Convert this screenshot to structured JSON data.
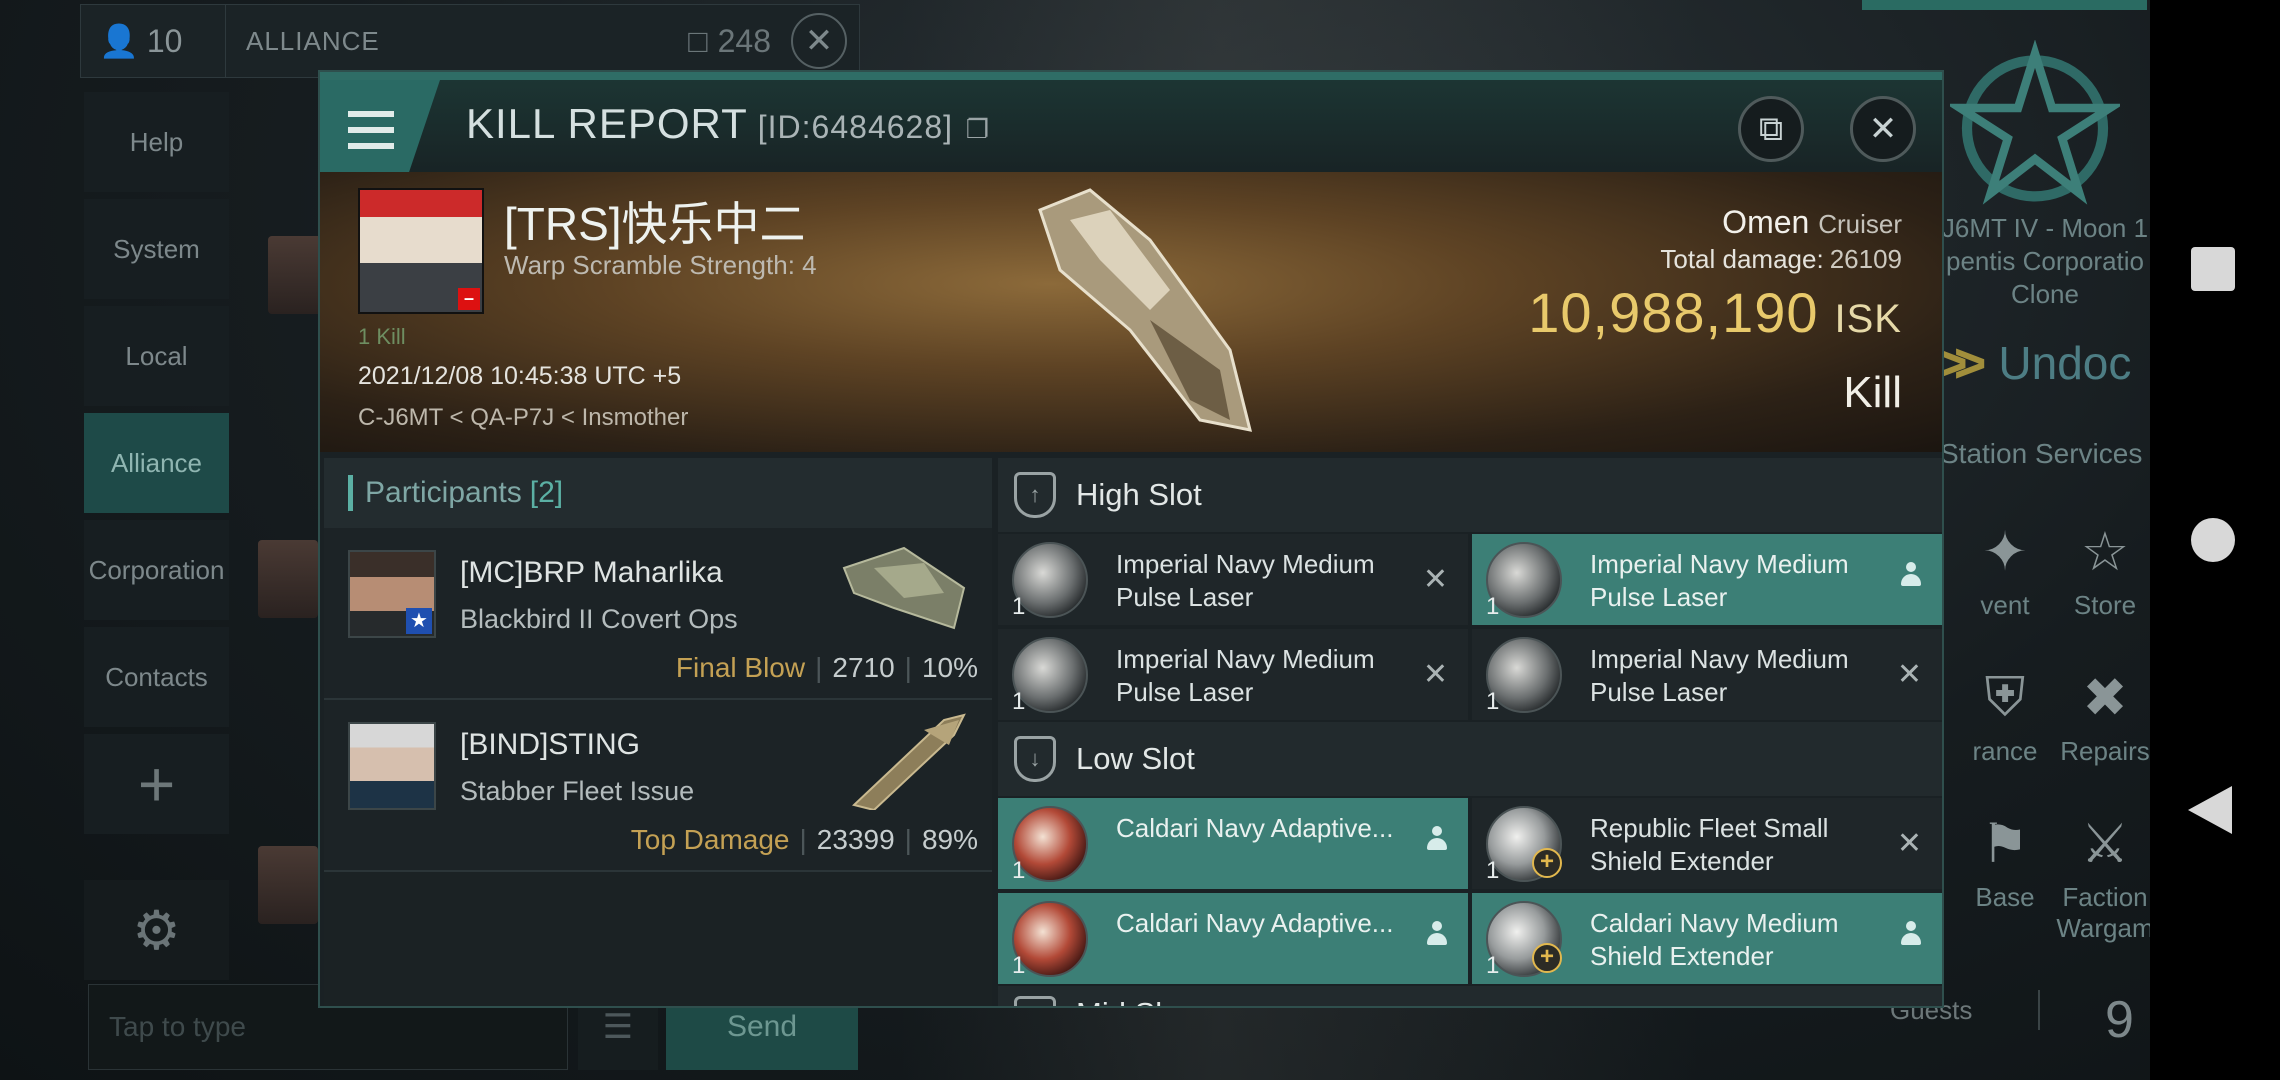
{
  "chat": {
    "member_count": "10",
    "channel": "ALLIANCE",
    "unread": "248",
    "nav": [
      "Help",
      "System",
      "Local",
      "Alliance",
      "Corporation",
      "Contacts"
    ],
    "active_nav": "Alliance",
    "input_placeholder": "Tap to type",
    "send_label": "Send"
  },
  "station": {
    "location_lines": [
      "J6MT IV - Moon 1",
      "pentis Corporatio",
      "Clone"
    ],
    "undock_label": "Undoc",
    "services_label": "Station Services",
    "services": [
      {
        "label": "vent",
        "icon": "event-icon"
      },
      {
        "label": "Store",
        "icon": "nes-store-icon"
      },
      {
        "label": "rance",
        "icon": "insurance-icon"
      },
      {
        "label": "Repairs",
        "icon": "repair-icon"
      },
      {
        "label": "Base",
        "icon": "base-icon"
      },
      {
        "label": "Faction Wargam",
        "icon": "faction-wargame-icon"
      }
    ],
    "guests_label": "Guests",
    "guests_count": "9"
  },
  "report": {
    "title": "KILL REPORT",
    "id_text": "[ID:6484628]",
    "victim": {
      "name": "[TRS]快乐中二",
      "warp_scramble": "Warp Scramble Strength: 4",
      "kills": "1 Kill",
      "datetime": "2021/12/08 10:45:38 UTC +5",
      "location": "C-J6MT < QA-P7J < Insmother",
      "ship_name": "Omen",
      "ship_class": "Cruiser",
      "total_damage_label": "Total damage:",
      "total_damage": "26109",
      "isk_value": "10,988,190",
      "isk_unit": "ISK",
      "result": "Kill"
    },
    "participants_label": "Participants",
    "participants_count": "[2]",
    "participants": [
      {
        "name": "[MC]BRP Maharlika",
        "ship": "Blackbird II Covert Ops",
        "role": "Final Blow",
        "damage": "2710",
        "percent": "10%"
      },
      {
        "name": "[BIND]STING",
        "ship": "Stabber Fleet Issue",
        "role": "Top Damage",
        "damage": "23399",
        "percent": "89%"
      }
    ],
    "high_slot_label": "High Slot",
    "high_slot": [
      {
        "name": "Imperial Navy Medium Pulse Laser",
        "qty": "1",
        "state": "destroyed"
      },
      {
        "name": "Imperial Navy Medium Pulse Laser",
        "qty": "1",
        "state": "dropped"
      },
      {
        "name": "Imperial Navy Medium Pulse Laser",
        "qty": "1",
        "state": "destroyed"
      },
      {
        "name": "Imperial Navy Medium Pulse Laser",
        "qty": "1",
        "state": "destroyed"
      }
    ],
    "low_slot_label": "Low Slot",
    "low_slot": [
      {
        "name": "Caldari Navy Adaptive...",
        "qty": "1",
        "state": "dropped"
      },
      {
        "name": "Republic Fleet Small Shield Extender",
        "qty": "1",
        "state": "destroyed"
      },
      {
        "name": "Caldari Navy Adaptive...",
        "qty": "1",
        "state": "dropped"
      },
      {
        "name": "Caldari Navy Medium Shield Extender",
        "qty": "1",
        "state": "dropped"
      }
    ],
    "mid_slot_label": "Mid Sl"
  }
}
